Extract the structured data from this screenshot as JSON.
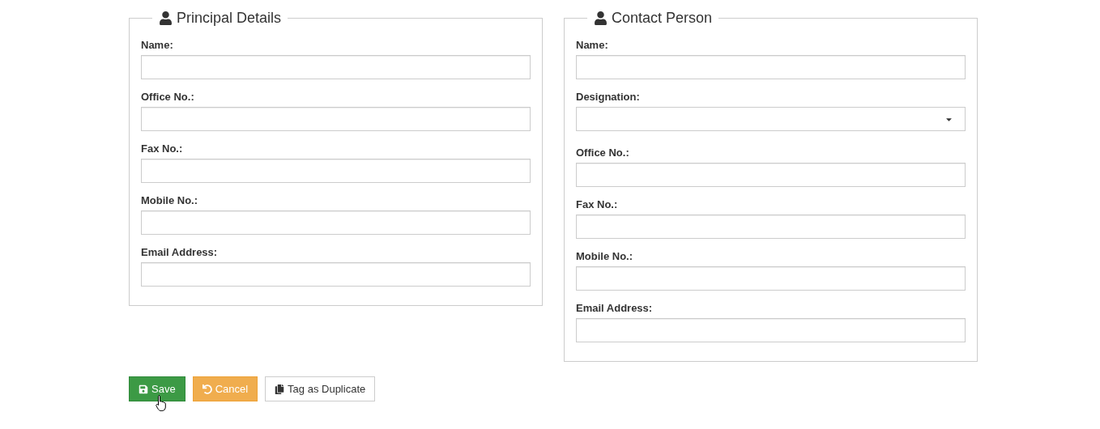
{
  "panels": [
    {
      "title": "Principal Details",
      "fields": [
        {
          "label": "Name:",
          "kind": "text"
        },
        {
          "label": "Office No.:",
          "kind": "text"
        },
        {
          "label": "Fax No.:",
          "kind": "text"
        },
        {
          "label": "Mobile No.:",
          "kind": "text"
        },
        {
          "label": "Email Address:",
          "kind": "text"
        }
      ]
    },
    {
      "title": "Contact Person",
      "fields": [
        {
          "label": "Name:",
          "kind": "text"
        },
        {
          "label": "Designation:",
          "kind": "select"
        },
        {
          "label": "Office No.:",
          "kind": "text"
        },
        {
          "label": "Fax No.:",
          "kind": "text"
        },
        {
          "label": "Mobile No.:",
          "kind": "text"
        },
        {
          "label": "Email Address:",
          "kind": "text"
        }
      ]
    }
  ],
  "buttons": [
    {
      "label": "Save",
      "kind": "success"
    },
    {
      "label": "Cancel",
      "kind": "warning"
    },
    {
      "label": "Tag as Duplicate",
      "kind": "default"
    }
  ]
}
